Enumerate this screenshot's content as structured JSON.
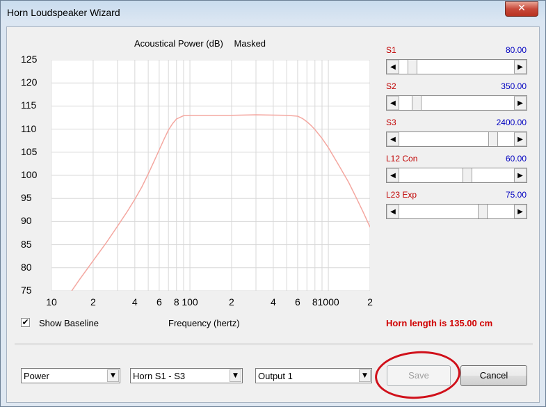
{
  "window": {
    "title": "Horn Loudspeaker Wizard",
    "close_glyph": "✕"
  },
  "chart_title": {
    "main": "Acoustical Power (dB)",
    "mode": "Masked"
  },
  "chart_data": {
    "type": "line",
    "title": "Acoustical Power (dB)   Masked",
    "xlabel": "Frequency (hertz)",
    "ylabel": "",
    "x_scale": "log",
    "xlim": [
      10,
      2000
    ],
    "ylim": [
      75,
      125
    ],
    "grid": true,
    "line_color": "#f4a7a0",
    "y_ticks": [
      "125",
      "120",
      "115",
      "110",
      "105",
      "100",
      "95",
      "90",
      "85",
      "80",
      "75"
    ],
    "x_ticks": [
      {
        "v": 10,
        "label": "10"
      },
      {
        "v": 20,
        "label": "2"
      },
      {
        "v": 40,
        "label": "4"
      },
      {
        "v": 60,
        "label": "6"
      },
      {
        "v": 80,
        "label": "8"
      },
      {
        "v": 100,
        "label": "100"
      },
      {
        "v": 200,
        "label": "2"
      },
      {
        "v": 400,
        "label": "4"
      },
      {
        "v": 600,
        "label": "6"
      },
      {
        "v": 800,
        "label": "8"
      },
      {
        "v": 1000,
        "label": "1000"
      },
      {
        "v": 2000,
        "label": "2"
      }
    ],
    "series": [
      {
        "values": [
          [
            14,
            75
          ],
          [
            16,
            77.5
          ],
          [
            20,
            81.5
          ],
          [
            25,
            85.5
          ],
          [
            30,
            89
          ],
          [
            35,
            92
          ],
          [
            40,
            94.8
          ],
          [
            45,
            97.5
          ],
          [
            50,
            100.3
          ],
          [
            55,
            103
          ],
          [
            60,
            105.5
          ],
          [
            65,
            107.8
          ],
          [
            70,
            109.8
          ],
          [
            75,
            111.2
          ],
          [
            80,
            112.2
          ],
          [
            90,
            112.9
          ],
          [
            100,
            113
          ],
          [
            200,
            113
          ],
          [
            300,
            113.1
          ],
          [
            500,
            113
          ],
          [
            600,
            112.8
          ],
          [
            650,
            112.3
          ],
          [
            700,
            111.6
          ],
          [
            750,
            110.8
          ],
          [
            800,
            109.9
          ],
          [
            900,
            108
          ],
          [
            1000,
            106
          ],
          [
            1200,
            102
          ],
          [
            1400,
            98.5
          ],
          [
            1600,
            95
          ],
          [
            1800,
            91.8
          ],
          [
            2000,
            88.8
          ]
        ]
      }
    ]
  },
  "baseline": {
    "label": "Show Baseline",
    "checked_glyph": "✔"
  },
  "freq_label": "Frequency (hertz)",
  "horn_length": "Horn length is 135.00 cm",
  "sliders": [
    {
      "label": "S1",
      "value": "80.00",
      "position": 0.08
    },
    {
      "label": "S2",
      "value": "350.00",
      "position": 0.12
    },
    {
      "label": "S3",
      "value": "2400.00",
      "position": 0.85
    },
    {
      "label": "L12  Con",
      "value": "60.00",
      "position": 0.6
    },
    {
      "label": "L23  Exp",
      "value": "75.00",
      "position": 0.75
    }
  ],
  "dropdowns": [
    {
      "value": "Power"
    },
    {
      "value": "Horn S1 - S3"
    },
    {
      "value": "Output 1"
    }
  ],
  "buttons": {
    "save": "Save",
    "cancel": "Cancel"
  },
  "glyphs": {
    "left": "◀",
    "right": "▶",
    "down": "▼"
  },
  "colors": {
    "label_red": "#c00000",
    "value_blue": "#0000c0",
    "annotation_red": "#d0101a"
  }
}
